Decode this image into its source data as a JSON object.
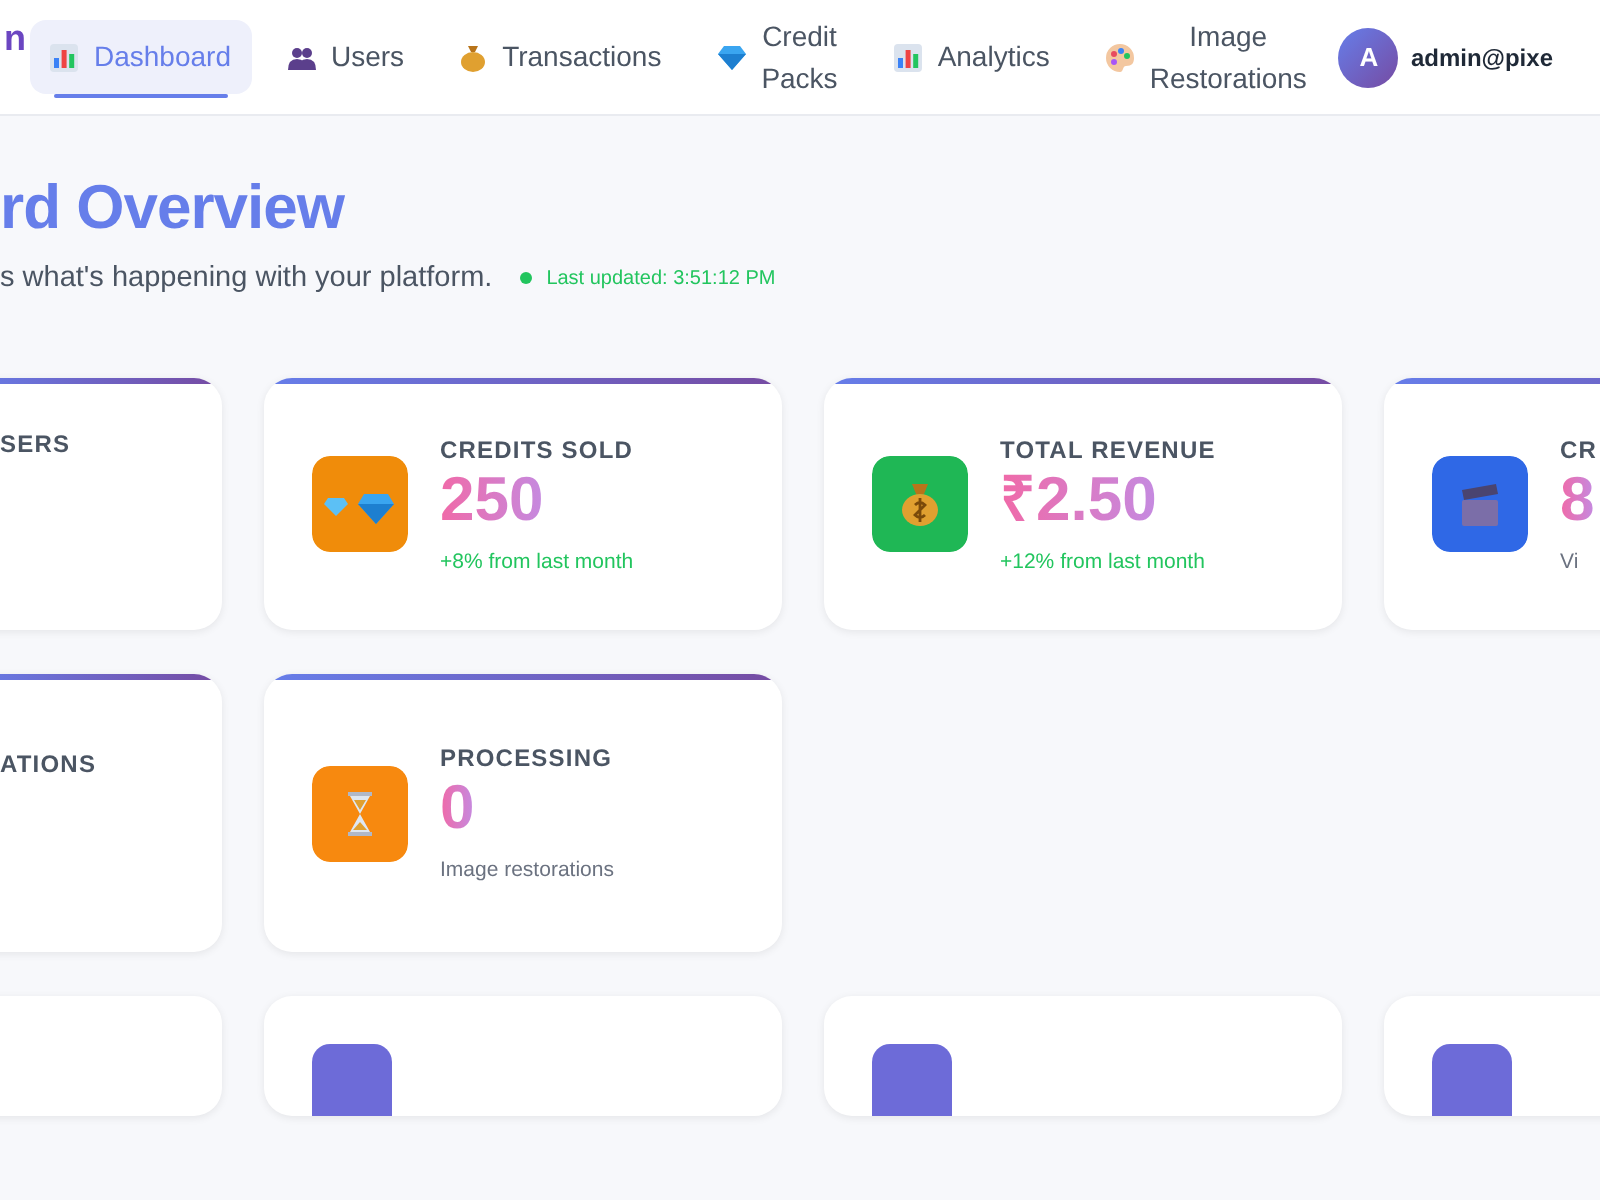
{
  "header": {
    "logo_fragment": "n",
    "nav": [
      {
        "label": "Dashboard",
        "selected": true
      },
      {
        "label": "Users",
        "selected": false
      },
      {
        "label": "Transactions",
        "selected": false
      },
      {
        "label": "Credit Packs",
        "selected": false
      },
      {
        "label": "Analytics",
        "selected": false
      },
      {
        "label": "Image Restorations",
        "selected": false
      }
    ],
    "user": {
      "avatar": "A",
      "email": "admin@pixe"
    }
  },
  "page": {
    "title": "rd Overview",
    "subtitle": "s what's happening with your platform.",
    "last_updated": "Last updated: 3:51:12 PM"
  },
  "stat_rows": [
    [
      {
        "kind": "partial",
        "label": "SERS"
      },
      {
        "kind": "trend",
        "label": "CREDITS SOLD",
        "color": "#f08c0a",
        "value": "250",
        "note": "+8% from last month"
      },
      {
        "kind": "trend",
        "label": "TOTAL REVENUE",
        "color": "#1fb755",
        "value": "₹2.50",
        "note": "+12% from last month"
      },
      {
        "kind": "info",
        "label": "CR",
        "color": "#2f68e6",
        "value": "8",
        "note": "Vi"
      }
    ],
    [
      {
        "kind": "partial",
        "label": "ATIONS"
      },
      {
        "kind": "info",
        "label": "PROCESSING",
        "color": "#f7890f",
        "value": "0",
        "note": "Image restorations"
      }
    ],
    [
      {
        "kind": "empty"
      },
      {
        "kind": "tile",
        "color": "#6d6bd8"
      },
      {
        "kind": "tile",
        "color": "#6d6bd8"
      },
      {
        "kind": "tile",
        "color": "#6d6bd8"
      }
    ]
  ]
}
